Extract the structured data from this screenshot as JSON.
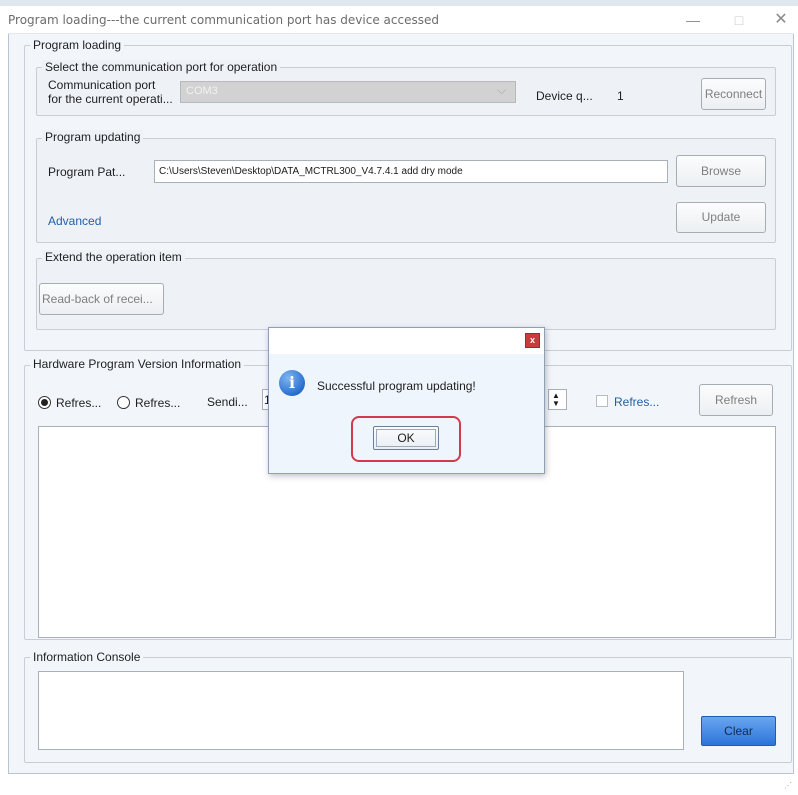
{
  "window": {
    "title": "Program loading---the current communication port has device accessed",
    "minimize_glyph": "—",
    "maximize_glyph": "□",
    "close_glyph": "✕"
  },
  "program_loading": {
    "group_label": "Program loading",
    "comm_group_label": "Select the communication port for operation",
    "comm_port_label_line1": "Communication port",
    "comm_port_label_line2": "for the current operati...",
    "comm_port_value": "COM3",
    "device_quantity_label": "Device q...",
    "device_quantity_value": "1",
    "reconnect_label": "Reconnect"
  },
  "program_updating": {
    "group_label": "Program updating",
    "path_label": "Program Pat...",
    "path_value": "C:\\Users\\Steven\\Desktop\\DATA_MCTRL300_V4.7.4.1 add dry mode",
    "browse_label": "Browse",
    "advanced_link": "Advanced",
    "update_label": "Update"
  },
  "extend": {
    "group_label": "Extend the operation item",
    "readback_label": "Read-back of recei..."
  },
  "hardware": {
    "group_label": "Hardware Program Version Information",
    "radio1_label": "Refres...",
    "radio1_checked": true,
    "radio2_label": "Refres...",
    "radio2_checked": false,
    "sending_label": "Sendi...",
    "sending_value": "1",
    "checkbox_label": "Refres...",
    "refresh_label": "Refresh"
  },
  "console": {
    "group_label": "Information Console",
    "clear_label": "Clear"
  },
  "dialog": {
    "close_glyph": "x",
    "info_glyph": "i",
    "message": "Successful program updating!",
    "ok_label": "OK"
  },
  "colors": {
    "accent_blue": "#2b74d9",
    "highlight_red": "#d03a4c",
    "link_blue": "#1f5fa5"
  }
}
